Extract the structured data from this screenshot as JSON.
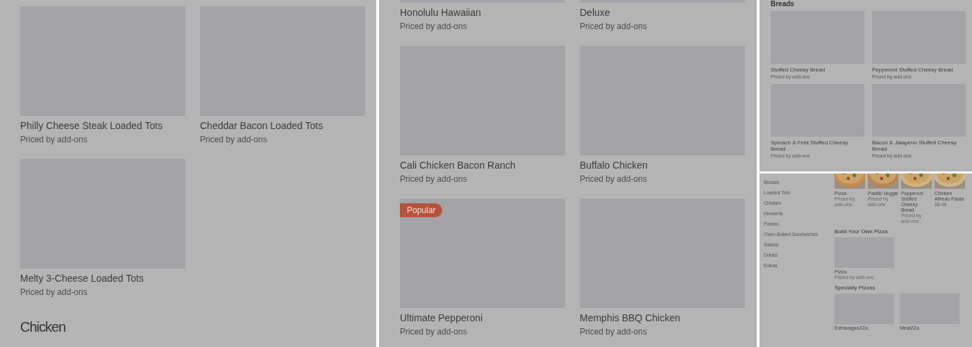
{
  "loaded_tots_panel": {
    "items": [
      {
        "name": "Philly Cheese Steak Loaded Tots",
        "price": "Priced by add-ons"
      },
      {
        "name": "Cheddar Bacon Loaded Tots",
        "price": "Priced by add-ons"
      },
      {
        "name": "Melty 3-Cheese Loaded Tots",
        "price": "Priced by add-ons"
      }
    ],
    "next_heading": "Chicken"
  },
  "pizzas_panel": {
    "items": [
      {
        "name": "Honolulu Hawaiian",
        "price": "Priced by add-ons"
      },
      {
        "name": "Deluxe",
        "price": "Priced by add-ons"
      },
      {
        "name": "Cali Chicken Bacon Ranch",
        "price": "Priced by add-ons"
      },
      {
        "name": "Buffalo Chicken",
        "price": "Priced by add-ons"
      },
      {
        "name": "Ultimate Pepperoni",
        "price": "Priced by add-ons",
        "badge": "Popular"
      },
      {
        "name": "Memphis BBQ Chicken",
        "price": "Priced by add-ons"
      }
    ]
  },
  "breads_panel": {
    "heading": "Breads",
    "items": [
      {
        "name": "Stuffed Cheesy Bread",
        "price": "Priced by add-ons"
      },
      {
        "name": "Pepperoni Stuffed Cheesy Bread",
        "price": "Priced by add-ons"
      },
      {
        "name": "Spinach & Feta Stuffed Cheesy Bread",
        "price": "Priced by add-ons"
      },
      {
        "name": "Bacon & Jalapeno Stuffed Cheesy Bread",
        "price": "Priced by add-ons"
      }
    ]
  },
  "menu_panel": {
    "categories": [
      "Breads",
      "Loaded Tots",
      "Chicken",
      "Desserts",
      "Pastas",
      "Oven-Baked Sandwiches",
      "Salads",
      "Drinks",
      "Extras"
    ],
    "featured": [
      {
        "name": "Pizza",
        "price": "Priced by add-ons"
      },
      {
        "name": "Pacific Veggie",
        "price": "Priced by add-ons"
      },
      {
        "name": "Pepperoni Stuffed Cheesy Bread",
        "price": "Priced by add-ons"
      },
      {
        "name": "Chicken Alfredo Pasta",
        "price": "$8.99"
      }
    ],
    "sections": [
      {
        "title": "Build Your Own Pizza",
        "items": [
          {
            "name": "Pizza",
            "price": "Priced by add-ons"
          }
        ]
      },
      {
        "title": "Specialty Pizzas",
        "items": [
          {
            "name": "ExtravaganZZa"
          },
          {
            "name": "MeatZZa"
          }
        ]
      }
    ]
  }
}
